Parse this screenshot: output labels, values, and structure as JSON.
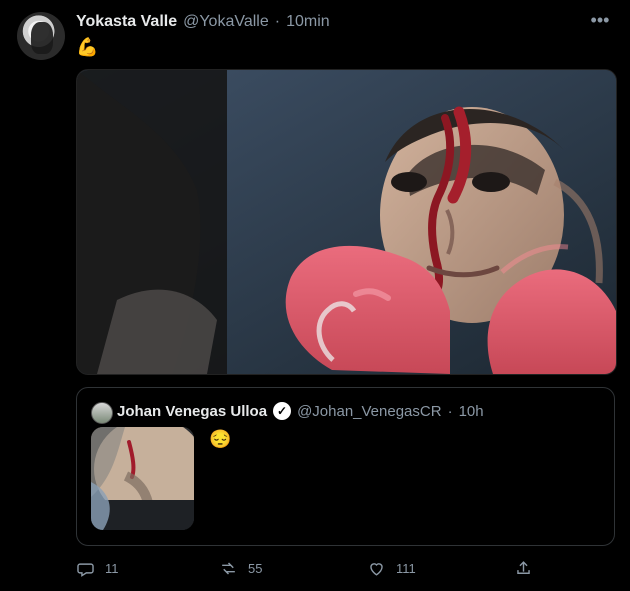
{
  "tweet": {
    "author_name": "Yokasta Valle",
    "author_handle": "@YokaValle",
    "separator": "·",
    "time": "10min",
    "text": "💪",
    "more_icon": "more-icon"
  },
  "quoted_tweet": {
    "author_name": "Johan Venegas Ulloa",
    "author_handle": "@Johan_VenegasCR",
    "separator": "·",
    "time": "10h",
    "text": "😔"
  },
  "actions": {
    "replies": "11",
    "retweets": "55",
    "likes": "111"
  },
  "icons": {
    "reply": "reply-icon",
    "retweet": "retweet-icon",
    "like": "heart-icon",
    "share": "share-icon",
    "verified": "verified-icon"
  }
}
